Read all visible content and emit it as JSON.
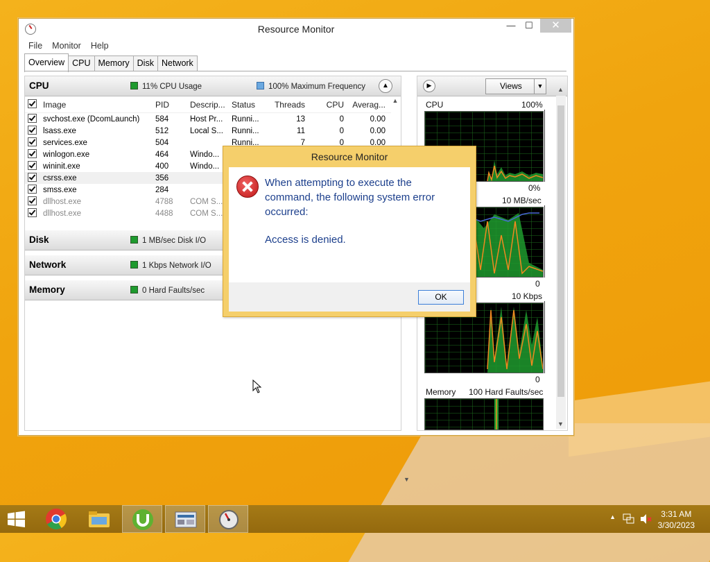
{
  "window": {
    "title": "Resource Monitor",
    "controls": {
      "minimize": "—",
      "maximize": "☐",
      "close": "✕"
    }
  },
  "menu": [
    "File",
    "Monitor",
    "Help"
  ],
  "tabs": [
    "Overview",
    "CPU",
    "Memory",
    "Disk",
    "Network"
  ],
  "active_tab": "Overview",
  "cpu_section": {
    "name": "CPU",
    "usage": "11% CPU Usage",
    "frequency": "100% Maximum Frequency",
    "columns": [
      "Image",
      "PID",
      "Descrip...",
      "Status",
      "Threads",
      "CPU",
      "Averag..."
    ],
    "rows": [
      {
        "image": "svchost.exe (DcomLaunch)",
        "pid": "584",
        "desc": "Host Pr...",
        "status": "Runni...",
        "threads": "13",
        "cpu": "0",
        "avg": "0.00"
      },
      {
        "image": "lsass.exe",
        "pid": "512",
        "desc": "Local S...",
        "status": "Runni...",
        "threads": "11",
        "cpu": "0",
        "avg": "0.00"
      },
      {
        "image": "services.exe",
        "pid": "504",
        "desc": "",
        "status": "Runni...",
        "threads": "7",
        "cpu": "0",
        "avg": "0.00"
      },
      {
        "image": "winlogon.exe",
        "pid": "464",
        "desc": "Windo...",
        "status": "",
        "threads": "",
        "cpu": "",
        "avg": ""
      },
      {
        "image": "wininit.exe",
        "pid": "400",
        "desc": "Windo...",
        "status": "",
        "threads": "",
        "cpu": "",
        "avg": ""
      },
      {
        "image": "csrss.exe",
        "pid": "356",
        "desc": "",
        "status": "",
        "threads": "",
        "cpu": "",
        "avg": ""
      },
      {
        "image": "smss.exe",
        "pid": "284",
        "desc": "",
        "status": "",
        "threads": "",
        "cpu": "",
        "avg": ""
      },
      {
        "image": "dllhost.exe",
        "pid": "4788",
        "desc": "COM S...",
        "status": "",
        "threads": "",
        "cpu": "",
        "avg": ""
      },
      {
        "image": "dllhost.exe",
        "pid": "4488",
        "desc": "COM S...",
        "status": "",
        "threads": "",
        "cpu": "",
        "avg": ""
      }
    ]
  },
  "disk_section": {
    "name": "Disk",
    "stat": "1 MB/sec Disk I/O"
  },
  "network_section": {
    "name": "Network",
    "stat": "1 Kbps Network I/O"
  },
  "memory_section": {
    "name": "Memory",
    "stat": "0 Hard Faults/sec"
  },
  "right_pane": {
    "views_label": "Views",
    "graphs": [
      {
        "title": "CPU",
        "max": "100%",
        "min": "0%"
      },
      {
        "title": "",
        "max": "10 MB/sec",
        "min": "0"
      },
      {
        "title": "",
        "max": "10 Kbps",
        "min": "0"
      },
      {
        "title": "Memory",
        "max": "100 Hard Faults/sec",
        "min": ""
      }
    ]
  },
  "dialog": {
    "title": "Resource Monitor",
    "message": "When attempting to execute the command, the following system error occurred:",
    "detail": "Access is denied.",
    "ok_label": "OK"
  },
  "taskbar": {
    "items": [
      "start-icon",
      "chrome-icon",
      "file-explorer-icon",
      "utorrent-icon",
      "control-panel-icon",
      "resource-monitor-icon"
    ],
    "clock_time": "3:31 AM",
    "clock_date": "3/30/2023"
  },
  "colors": {
    "desktop": "#f0a40e",
    "taskbar": "#9a6e10",
    "graph_green": "#1e9a2e",
    "dialog_text": "#1c3f8c",
    "dialog_frame": "#f5cf6b"
  }
}
